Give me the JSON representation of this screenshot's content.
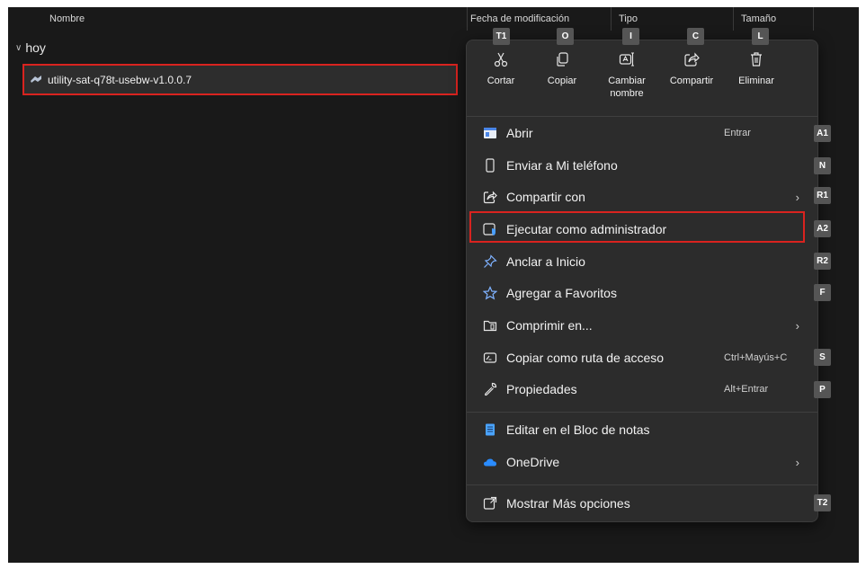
{
  "columns": {
    "name": "Nombre",
    "modified": "Fecha de modificación",
    "type": "Tipo",
    "size": "Tamaño"
  },
  "group": {
    "label": "hoy"
  },
  "file": {
    "name": "utility-sat-q78t-usebw-v1.0.0.7"
  },
  "quick_actions": [
    {
      "label": "Cortar",
      "icon": "scissors-icon",
      "key": "T1"
    },
    {
      "label": "Copiar",
      "icon": "copy-icon",
      "key": "O"
    },
    {
      "label": "Cambiar nombre",
      "icon": "rename-icon",
      "key": "I"
    },
    {
      "label": "Compartir",
      "icon": "share-icon",
      "key": "C"
    },
    {
      "label": "Eliminar",
      "icon": "trash-icon",
      "key": "L"
    }
  ],
  "menu_items": [
    {
      "label": "Abrir",
      "icon": "open-app-icon",
      "shortcut": "Entrar",
      "key": "A1"
    },
    {
      "label": "Enviar a Mi teléfono",
      "icon": "phone-icon",
      "key": "N"
    },
    {
      "label": "Compartir con",
      "icon": "share-icon",
      "submenu": true,
      "key": "R1"
    },
    {
      "label": "Ejecutar como administrador",
      "icon": "admin-shield-icon",
      "key": "A2"
    },
    {
      "label": "Anclar a Inicio",
      "icon": "pin-icon",
      "key": "R2"
    },
    {
      "label": "Agregar a Favoritos",
      "icon": "star-icon",
      "key": "F"
    },
    {
      "label": "Comprimir en...",
      "icon": "zip-folder-icon",
      "submenu": true
    },
    {
      "label": "Copiar como ruta de acceso",
      "icon": "path-icon",
      "shortcut": "Ctrl+Mayús+C",
      "key": "S"
    },
    {
      "label": "Propiedades",
      "icon": "wrench-icon",
      "shortcut": "Alt+Entrar",
      "key": "P"
    },
    {
      "label": "Editar en el Bloc de notas",
      "icon": "notepad-icon"
    },
    {
      "label": "OneDrive",
      "icon": "cloud-icon",
      "submenu": true
    },
    {
      "label": "Mostrar Más opciones",
      "icon": "more-options-icon",
      "key": "T2"
    }
  ],
  "colors": {
    "background": "#191919",
    "menu": "#2c2c2c",
    "highlight": "#d9231f",
    "key_badge": "#555555"
  }
}
